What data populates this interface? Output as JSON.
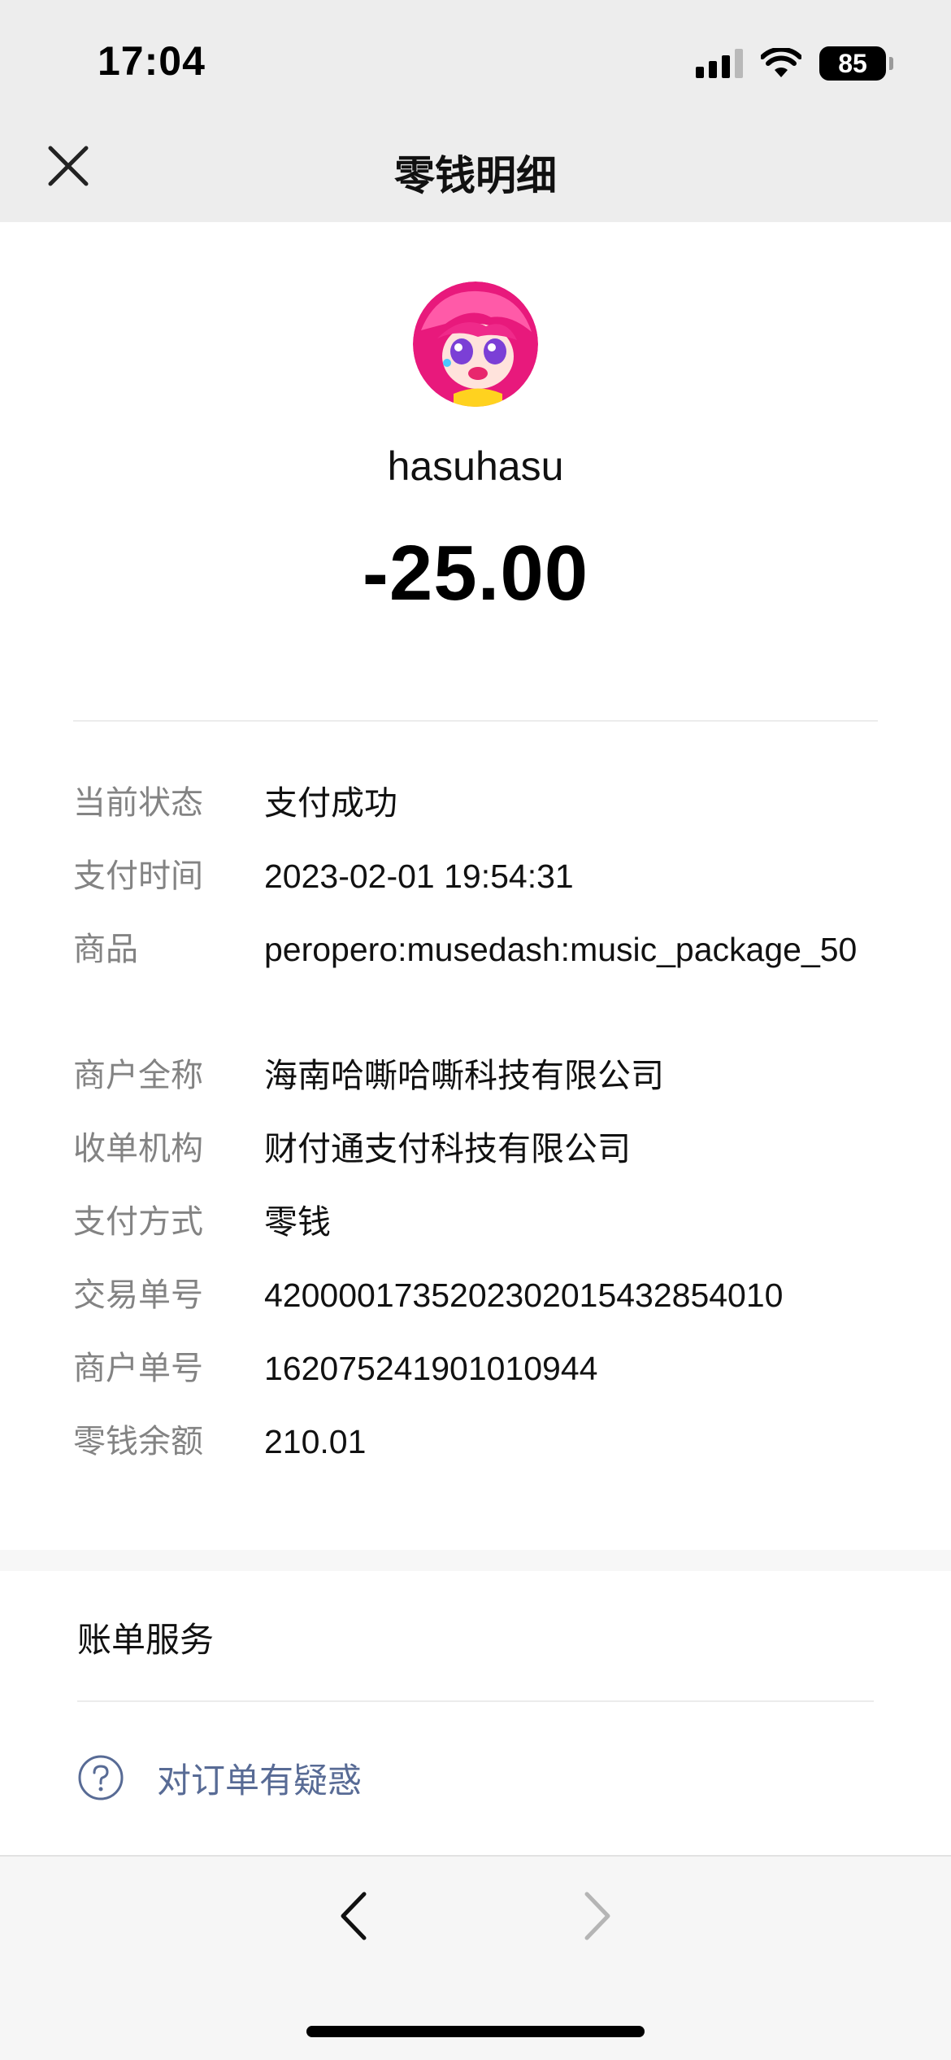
{
  "status_bar": {
    "time": "17:04",
    "battery": "85",
    "icons": [
      "signal-icon",
      "wifi-icon",
      "battery-icon"
    ]
  },
  "header": {
    "title": "零钱明细",
    "close_icon": "close-icon"
  },
  "transaction": {
    "payee": "hasuhasu",
    "amount": "-25.00",
    "details": [
      {
        "label": "当前状态",
        "value": "支付成功"
      },
      {
        "label": "支付时间",
        "value": "2023-02-01 19:54:31"
      },
      {
        "label": "商品",
        "value": "peropero:musedash:music_package_50"
      },
      {
        "label": "商户全称",
        "value": "海南哈嘶哈嘶科技有限公司"
      },
      {
        "label": "收单机构",
        "value": "财付通支付科技有限公司"
      },
      {
        "label": "支付方式",
        "value": "零钱"
      },
      {
        "label": "交易单号",
        "value": "4200001735202302015432854010"
      },
      {
        "label": "商户单号",
        "value": "162075241901010944"
      },
      {
        "label": "零钱余额",
        "value": "210.01"
      }
    ]
  },
  "services": {
    "title": "账单服务",
    "help_link": "对订单有疑惑"
  },
  "colors": {
    "link": "#586b95",
    "label_grey": "#838383",
    "header_bg": "#ededed"
  }
}
